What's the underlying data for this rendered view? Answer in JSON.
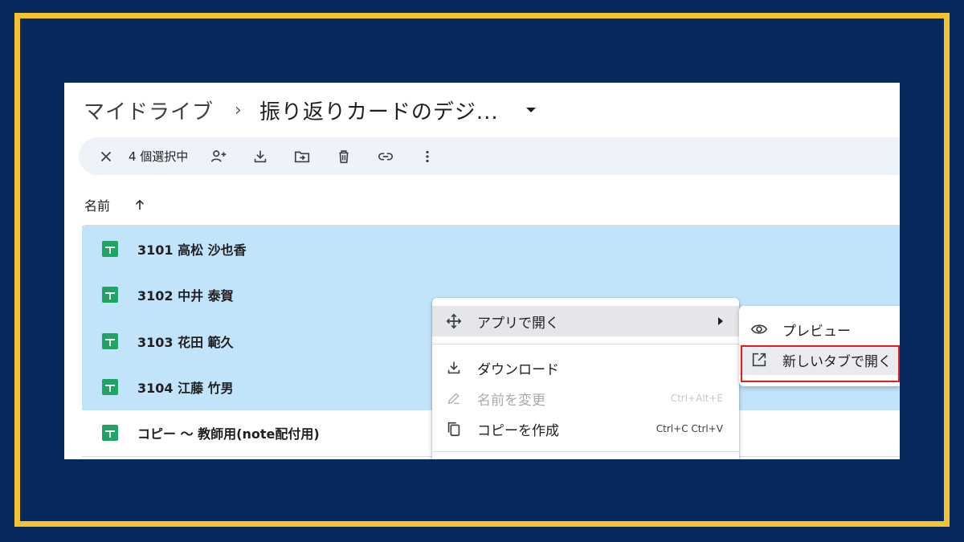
{
  "breadcrumb": {
    "root": "マイドライブ",
    "separator": "›",
    "current": "振り返りカードのデジ..."
  },
  "toolbar": {
    "selected_count": "4 個選択中",
    "icons": [
      "close-icon",
      "share-icon",
      "download-icon",
      "move-icon",
      "trash-icon",
      "link-icon",
      "more-vert-icon"
    ]
  },
  "list": {
    "column_name": "名前",
    "sort": "ascending",
    "rows": [
      {
        "name": "3101 高松 沙也香",
        "selected": true
      },
      {
        "name": "3102 中井 泰賀",
        "selected": true
      },
      {
        "name": "3103 花田 範久",
        "selected": true
      },
      {
        "name": "3104 江藤 竹男",
        "selected": true
      },
      {
        "name": "コピー ～ 教師用(note配付用)",
        "selected": false
      }
    ]
  },
  "context_menu": {
    "open_with": "アプリで開く",
    "download": "ダウンロード",
    "rename": "名前を変更",
    "rename_shortcut": "Ctrl+Alt+E",
    "make_copy": "コピーを作成",
    "make_copy_shortcut": "Ctrl+C Ctrl+V"
  },
  "submenu": {
    "preview": "プレビュー",
    "open_new_tab": "新しいタブで開く"
  },
  "colors": {
    "frame_border": "#f6c330",
    "frame_background": "#062a5c",
    "selected_row": "#c2e4fb",
    "sheets_green": "#1fa463",
    "highlight": "#e02020"
  }
}
